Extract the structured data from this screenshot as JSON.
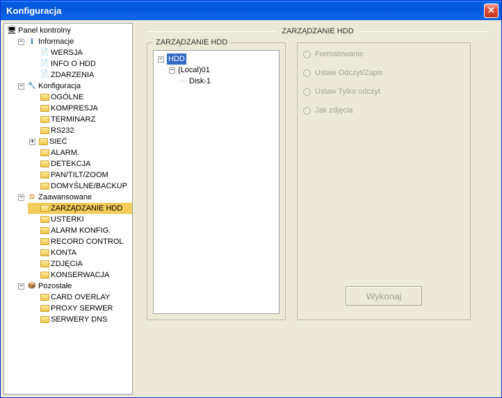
{
  "window": {
    "title": "Konfiguracja"
  },
  "tree": {
    "root": "Panel kontrolny",
    "info_group": "Informacje",
    "info": {
      "wersja": "WERSJA",
      "hdd": "INFO O HDD",
      "zdarzenia": "ZDARZENIA"
    },
    "konfig_group": "Konfiguracja",
    "konfig": {
      "ogolne": "OGÓLNE",
      "kompresja": "KOMPRESJA",
      "terminarz": "TERMINARZ",
      "rs232": "RS232",
      "siec": "SIEĆ",
      "alarm": "ALARM.",
      "detekcja": "DETEKCJA",
      "ptz": "PAN/TILT/ZOOM",
      "domyslne": "DOMYŚLNE/BACKUP"
    },
    "adv_group": "Zaawansowane",
    "adv": {
      "hdd": "ZARZĄDZANIE HDD",
      "usterki": "USTERKI",
      "alarmk": "ALARM KONFIG.",
      "rec": "RECORD CONTROL",
      "konta": "KONTA",
      "zdjecia": "ZDJĘCIA",
      "kons": "KONSERWACJA"
    },
    "other_group": "Pozostałe",
    "other": {
      "card": "CARD OVERLAY",
      "proxy": "PROXY SERWER",
      "dns": "SERWERY DNS"
    }
  },
  "main": {
    "page_title": "ZARZĄDZANIE HDD",
    "fieldset_title": "ZARZĄDZANIE HDD",
    "hdd_tree": {
      "root": "HDD",
      "local": "(Local)01",
      "disk": "Disk-1"
    },
    "options": {
      "format": "Formatowanie",
      "rw": "Ustaw Odczyt/Zapis",
      "ro": "Ustaw Tylko odczyt",
      "snap": "Jak zdjęcia"
    },
    "exec": "Wykonaj"
  }
}
